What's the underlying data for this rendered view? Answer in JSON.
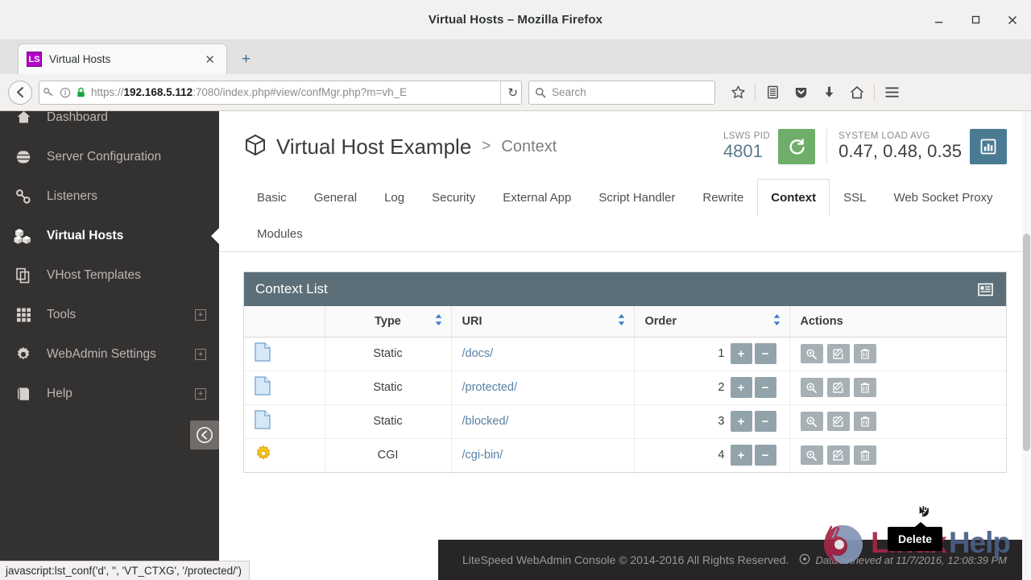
{
  "window": {
    "title": "Virtual Hosts – Mozilla Firefox",
    "minimize": "minimize-icon",
    "maximize": "maximize-icon",
    "close": "close-icon"
  },
  "tabbar": {
    "favicon_text": "LS",
    "tab_title": "Virtual Hosts",
    "close_label": "✕",
    "new_tab_label": "+"
  },
  "navbar": {
    "back_label": "←",
    "url_scheme": "https://",
    "url_host": "192.168.5.112",
    "url_rest": ":7080/index.php#view/confMgr.php?m=vh_E",
    "reload_label": "↻",
    "search_placeholder": "Search",
    "icons": [
      "bookmark-star-icon",
      "library-icon",
      "pocket-icon",
      "downloads-icon",
      "home-icon",
      "menu-icon"
    ]
  },
  "sidebar": {
    "items": [
      {
        "label": "Dashboard",
        "icon": "home-icon",
        "active": false,
        "expandable": false
      },
      {
        "label": "Server Configuration",
        "icon": "globe-icon",
        "active": false,
        "expandable": false
      },
      {
        "label": "Listeners",
        "icon": "link-icon",
        "active": false,
        "expandable": false
      },
      {
        "label": "Virtual Hosts",
        "icon": "cubes-icon",
        "active": true,
        "expandable": false
      },
      {
        "label": "VHost Templates",
        "icon": "copy-icon",
        "active": false,
        "expandable": false
      },
      {
        "label": "Tools",
        "icon": "grid-icon",
        "active": false,
        "expandable": true
      },
      {
        "label": "WebAdmin Settings",
        "icon": "gear-icon",
        "active": false,
        "expandable": true
      },
      {
        "label": "Help",
        "icon": "book-icon",
        "active": false,
        "expandable": true
      }
    ],
    "expand_label": "+",
    "collapse_label": "collapse-sidebar-icon"
  },
  "header": {
    "title": "Virtual Host Example",
    "separator": ">",
    "subtitle": "Context",
    "pid_label": "LSWS PID",
    "pid_value": "4801",
    "restart_icon": "restart-icon",
    "load_label": "SYSTEM LOAD AVG",
    "load_value": "0.47, 0.48, 0.35",
    "chart_icon": "bar-chart-icon"
  },
  "tabs": [
    {
      "label": "Basic",
      "active": false
    },
    {
      "label": "General",
      "active": false
    },
    {
      "label": "Log",
      "active": false
    },
    {
      "label": "Security",
      "active": false
    },
    {
      "label": "External App",
      "active": false
    },
    {
      "label": "Script Handler",
      "active": false
    },
    {
      "label": "Rewrite",
      "active": false
    },
    {
      "label": "Context",
      "active": true
    },
    {
      "label": "SSL",
      "active": false
    },
    {
      "label": "Web Socket Proxy",
      "active": false
    },
    {
      "label": "Modules",
      "active": false
    }
  ],
  "panel": {
    "title": "Context List",
    "list_icon": "list-view-icon",
    "columns": [
      "",
      "Type",
      "URI",
      "Order",
      "Actions"
    ],
    "rows": [
      {
        "icon": "document-icon",
        "type": "Static",
        "uri": "/docs/",
        "order": "1"
      },
      {
        "icon": "document-icon",
        "type": "Static",
        "uri": "/protected/",
        "order": "2"
      },
      {
        "icon": "document-icon",
        "type": "Static",
        "uri": "/blocked/",
        "order": "3"
      },
      {
        "icon": "gear-icon",
        "type": "CGI",
        "uri": "/cgi-bin/",
        "order": "4"
      }
    ],
    "order_up": "+",
    "order_down": "−",
    "action_icons": [
      "view-icon",
      "edit-icon",
      "delete-icon"
    ]
  },
  "tooltip": {
    "text": "Delete"
  },
  "footer": {
    "copyright": "LiteSpeed WebAdmin Console © 2014-2016 All Rights Reserved.",
    "retrieved": "Data retrieved at 11/7/2016, 12:08:39 PM",
    "clock_icon": "clock-icon"
  },
  "watermark": {
    "part1": "Linux",
    "part2": "Help"
  },
  "statusbar": {
    "text": "javascript:lst_conf('d', '', 'VT_CTXG', '/protected/')"
  },
  "colors": {
    "sidebar_bg": "#343231",
    "panel_header": "#5c6f78",
    "restart_green": "#6fae6a",
    "chart_blue": "#4a7b93",
    "link_blue": "#5a81a6",
    "order_btn": "#93a3ab",
    "action_btn": "#a7b0b5",
    "watermark_linux": "#a32647",
    "watermark_help": "#4a5f86"
  }
}
